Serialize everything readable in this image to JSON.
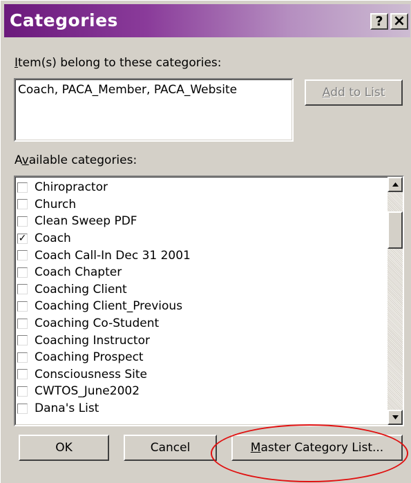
{
  "window": {
    "title": "Categories",
    "help_glyph": "?",
    "close_glyph": "×"
  },
  "assigned": {
    "label_access_key": "I",
    "label_rest": "tem(s) belong to these categories:",
    "value": "Coach, PACA_Member, PACA_Website",
    "add_button": {
      "access_key": "A",
      "rest": "dd to List",
      "enabled": false
    }
  },
  "available": {
    "label_pre": "A",
    "label_access_key": "v",
    "label_rest": "ailable categories:",
    "items": [
      {
        "label": "Chiropractor",
        "checked": false
      },
      {
        "label": "Church",
        "checked": false
      },
      {
        "label": "Clean Sweep PDF",
        "checked": false
      },
      {
        "label": "Coach",
        "checked": true
      },
      {
        "label": "Coach Call-In Dec 31 2001",
        "checked": false
      },
      {
        "label": "Coach Chapter",
        "checked": false
      },
      {
        "label": "Coaching Client",
        "checked": false
      },
      {
        "label": "Coaching Client_Previous",
        "checked": false
      },
      {
        "label": "Coaching Co-Student",
        "checked": false
      },
      {
        "label": "Coaching Instructor",
        "checked": false
      },
      {
        "label": "Coaching Prospect",
        "checked": false
      },
      {
        "label": "Consciousness Site",
        "checked": false
      },
      {
        "label": "CWTOS_June2002",
        "checked": false
      },
      {
        "label": "Dana's List",
        "checked": false
      }
    ],
    "check_glyph": "✓"
  },
  "buttons": {
    "ok": "OK",
    "cancel": "Cancel",
    "master_access_key": "M",
    "master_rest": "aster Category List..."
  },
  "colors": {
    "annotation": "#e01010",
    "title_gradient_start": "#6b1a7c"
  }
}
